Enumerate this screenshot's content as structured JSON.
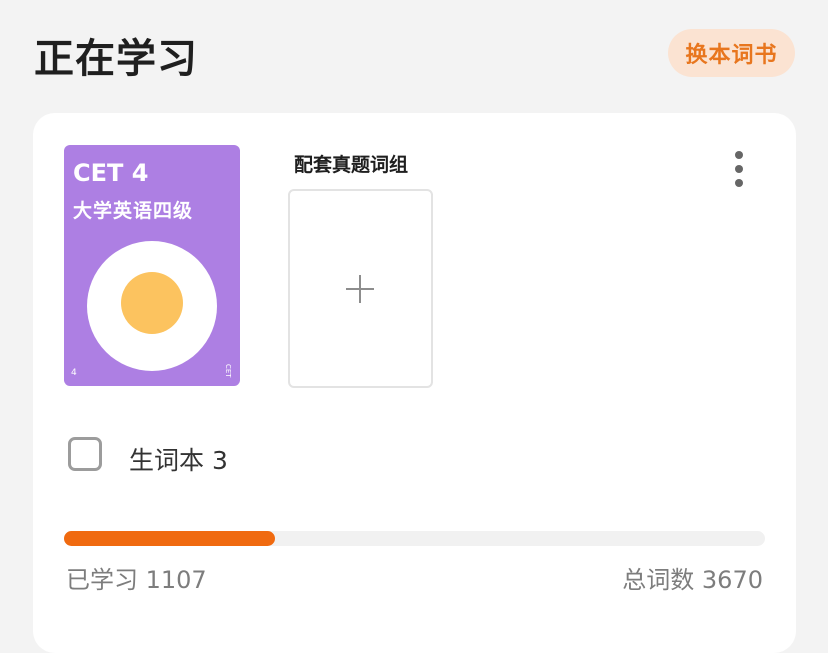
{
  "header": {
    "title": "正在学习",
    "change_book_label": "换本词书"
  },
  "book": {
    "cover_title": "CET 4",
    "cover_subtitle": "大学英语四级",
    "cover_level": "4",
    "cover_mark": "CET",
    "cover_color": "#ad7fe3"
  },
  "matching_set": {
    "label": "配套真题词组",
    "add_icon": "plus-icon"
  },
  "menu": {
    "icon": "more-vertical-icon"
  },
  "vocab_book": {
    "label": "生词本 3",
    "checked": false
  },
  "progress": {
    "learned_label": "已学习 1107",
    "total_label": "总词数 3670",
    "learned": 1107,
    "total": 3670,
    "accent": "#f06a10"
  }
}
